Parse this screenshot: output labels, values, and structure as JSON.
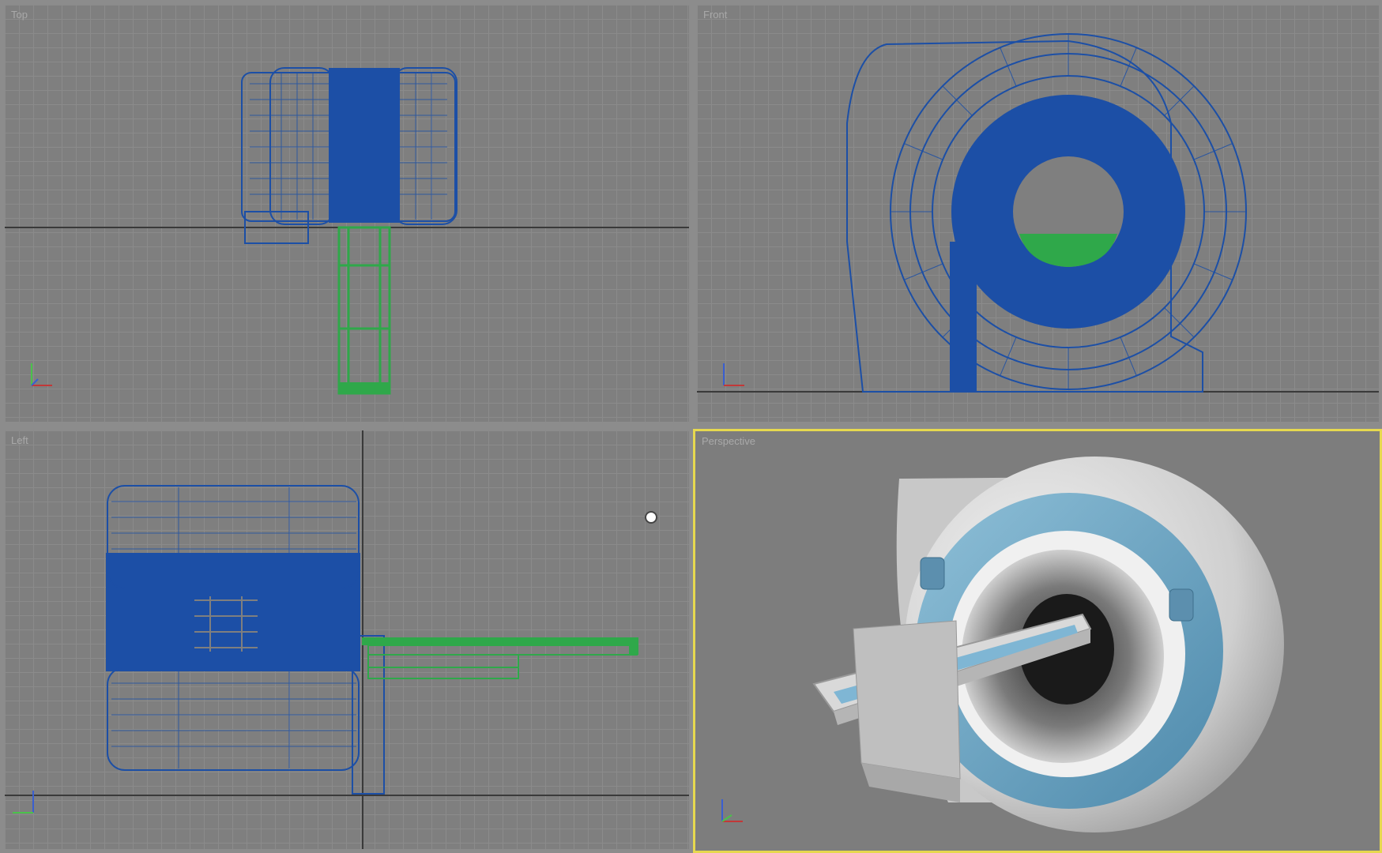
{
  "viewports": {
    "top": {
      "label": "Top"
    },
    "front": {
      "label": "Front"
    },
    "left": {
      "label": "Left"
    },
    "perspective": {
      "label": "Perspective",
      "active": true
    }
  },
  "colors": {
    "wireframe_blue": "#1c4fa6",
    "wireframe_green": "#2fa84a",
    "active_border": "#e6d84f",
    "grid_background": "#7f7f7f"
  }
}
